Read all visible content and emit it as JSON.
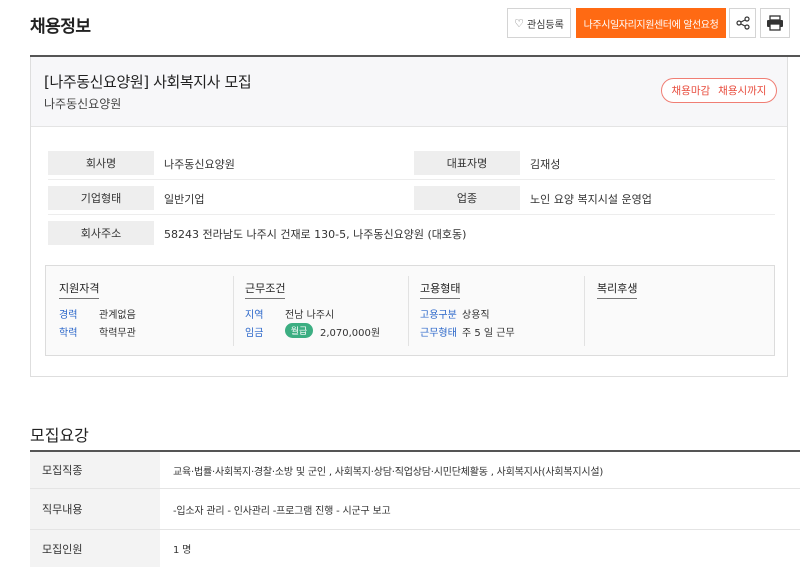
{
  "page": {
    "title": "채용정보"
  },
  "toolbar": {
    "favorite_label": "관심등록",
    "favorite_icon": "heart-outline-icon",
    "request_label": "나주시일자리지원센터에 알선요청",
    "share_icon": "share-icon",
    "print_icon": "printer-icon"
  },
  "colors": {
    "accent_orange": "#ff6a13",
    "status_red": "#e84c3d",
    "link_blue": "#2a66c9",
    "badge_green": "#3cae82"
  },
  "job": {
    "title": "[나주동신요양원] 사회복지사 모집",
    "company": "나주동신요양원",
    "status": {
      "closing": "채용마감",
      "until": "채용시까지"
    }
  },
  "company_info": {
    "name_label": "회사명",
    "name_value": "나주동신요양원",
    "ceo_label": "대표자명",
    "ceo_value": "김재성",
    "type_label": "기업형태",
    "type_value": "일반기업",
    "industry_label": "업종",
    "industry_value": "노인 요양 복지시설 운영업",
    "address_label": "회사주소",
    "address_value": "58243 전라남도 나주시 건재로 130-5, 나주동신요양원 (대호동)"
  },
  "conditions": {
    "qualification": {
      "heading": "지원자격",
      "career_key": "경력",
      "career_value": "관계없음",
      "education_key": "학력",
      "education_value": "학력무관"
    },
    "work": {
      "heading": "근무조건",
      "region_key": "지역",
      "region_value": "전남 나주시",
      "wage_key": "임금",
      "wage_badge": "월급",
      "wage_value": "2,070,000원"
    },
    "employment": {
      "heading": "고용형태",
      "type_key": "고용구분",
      "type_value": "상용직",
      "schedule_key": "근무형태",
      "schedule_value": "주 5 일 근무"
    },
    "welfare": {
      "heading": "복리후생"
    }
  },
  "recruitment": {
    "section_title": "모집요강",
    "rows": [
      {
        "label": "모집직종",
        "value": "교육·법률·사회복지·경찰·소방 및 군인 , 사회복지·상담·직업상담·시민단체활동 , 사회복지사(사회복지시설)"
      },
      {
        "label": "직무내용",
        "value": "-입소자 관리 - 인사관리 -프로그램 진행 - 시군구 보고"
      },
      {
        "label": "모집인원",
        "value": "1 명"
      }
    ]
  }
}
